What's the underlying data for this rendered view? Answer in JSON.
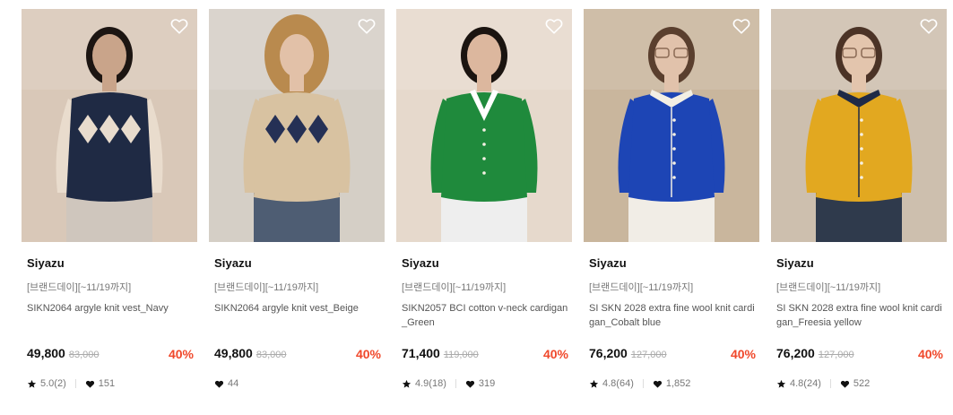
{
  "products": [
    {
      "brand": "Siyazu",
      "promo": "[브랜드데이][~11/19까지]",
      "name": "SIKN2064 argyle knit vest_Navy",
      "price": "49,800",
      "original_price": "83,000",
      "discount": "40%",
      "rating": "5.0(2)",
      "likes": "151",
      "colors": {
        "bg": "#d9c8b8",
        "garment": "#1f2a44",
        "accent": "#e9dccd",
        "skin": "#c9a48a",
        "hair": "#1c1512",
        "bottom": "#cfc6bd"
      }
    },
    {
      "brand": "Siyazu",
      "promo": "[브랜드데이][~11/19까지]",
      "name": "SIKN2064 argyle knit vest_Beige",
      "price": "49,800",
      "original_price": "83,000",
      "discount": "40%",
      "rating": "",
      "likes": "44",
      "colors": {
        "bg": "#d5cfc6",
        "garment": "#d8c2a1",
        "accent": "#253055",
        "skin": "#e2c1a8",
        "hair": "#b98a4e",
        "bottom": "#4e5d73"
      }
    },
    {
      "brand": "Siyazu",
      "promo": "[브랜드데이][~11/19까지]",
      "name": "SIKN2057 BCI cotton v-neck cardigan_Green",
      "price": "71,400",
      "original_price": "119,000",
      "discount": "40%",
      "rating": "4.9(18)",
      "likes": "319",
      "colors": {
        "bg": "#e6d9cc",
        "garment": "#1f8a3c",
        "accent": "#ffffff",
        "skin": "#dcb79e",
        "hair": "#1b1410",
        "bottom": "#eeeeee"
      }
    },
    {
      "brand": "Siyazu",
      "promo": "[브랜드데이][~11/19까지]",
      "name": "SI SKN 2028 extra fine wool knit cardigan_Cobalt blue",
      "price": "76,200",
      "original_price": "127,000",
      "discount": "40%",
      "rating": "4.8(64)",
      "likes": "1,852",
      "colors": {
        "bg": "#c9b69d",
        "garment": "#1d45b5",
        "accent": "#f3efe4",
        "skin": "#e1c2ab",
        "hair": "#5a3f2e",
        "bottom": "#f1ede6"
      }
    },
    {
      "brand": "Siyazu",
      "promo": "[브랜드데이][~11/19까지]",
      "name": "SI SKN 2028 extra fine wool knit cardigan_Freesia yellow",
      "price": "76,200",
      "original_price": "127,000",
      "discount": "40%",
      "rating": "4.8(24)",
      "likes": "522",
      "colors": {
        "bg": "#cdbfae",
        "garment": "#e2a820",
        "accent": "#1e2a47",
        "skin": "#e3c5ad",
        "hair": "#4b3326",
        "bottom": "#2f3a4c"
      }
    }
  ]
}
